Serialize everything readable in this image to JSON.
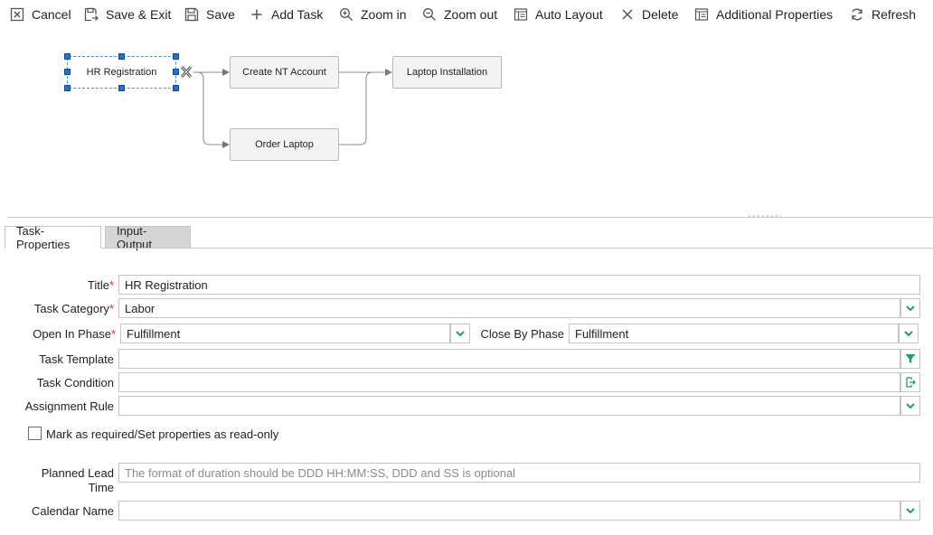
{
  "toolbar": {
    "cancel": "Cancel",
    "save_exit": "Save & Exit",
    "save": "Save",
    "add_task": "Add Task",
    "zoom_in": "Zoom in",
    "zoom_out": "Zoom out",
    "auto_layout": "Auto Layout",
    "delete": "Delete",
    "additional_properties": "Additional Properties",
    "refresh": "Refresh"
  },
  "diagram": {
    "nodes": {
      "hr_registration": "HR Registration",
      "create_nt_account": "Create NT Account",
      "laptop_installation": "Laptop Installation",
      "order_laptop": "Order Laptop"
    }
  },
  "tabs": {
    "task_properties": "Task-Properties",
    "input_output": "Input-Output"
  },
  "form": {
    "title_label": "Title",
    "title_value": "HR Registration",
    "task_category_label": "Task Category",
    "task_category_value": "Labor",
    "open_in_phase_label": "Open In Phase",
    "open_in_phase_value": "Fulfillment",
    "close_by_phase_label": "Close By Phase",
    "close_by_phase_value": "Fulfillment",
    "task_template_label": "Task Template",
    "task_template_value": "",
    "task_condition_label": "Task Condition",
    "task_condition_value": "",
    "assignment_rule_label": "Assignment Rule",
    "assignment_rule_value": "",
    "mark_required_label": "Mark as required/Set properties as read-only",
    "planned_lead_label_1": "Planned Lead",
    "planned_lead_label_2": "Time",
    "planned_lead_placeholder": "The format of duration should be DDD HH:MM:SS, DDD and SS is optional",
    "calendar_name_label": "Calendar Name",
    "calendar_name_value": ""
  },
  "colors": {
    "accent_green": "#1e9e64",
    "selection_blue": "#1976d2",
    "required_red": "#d32f2f"
  }
}
